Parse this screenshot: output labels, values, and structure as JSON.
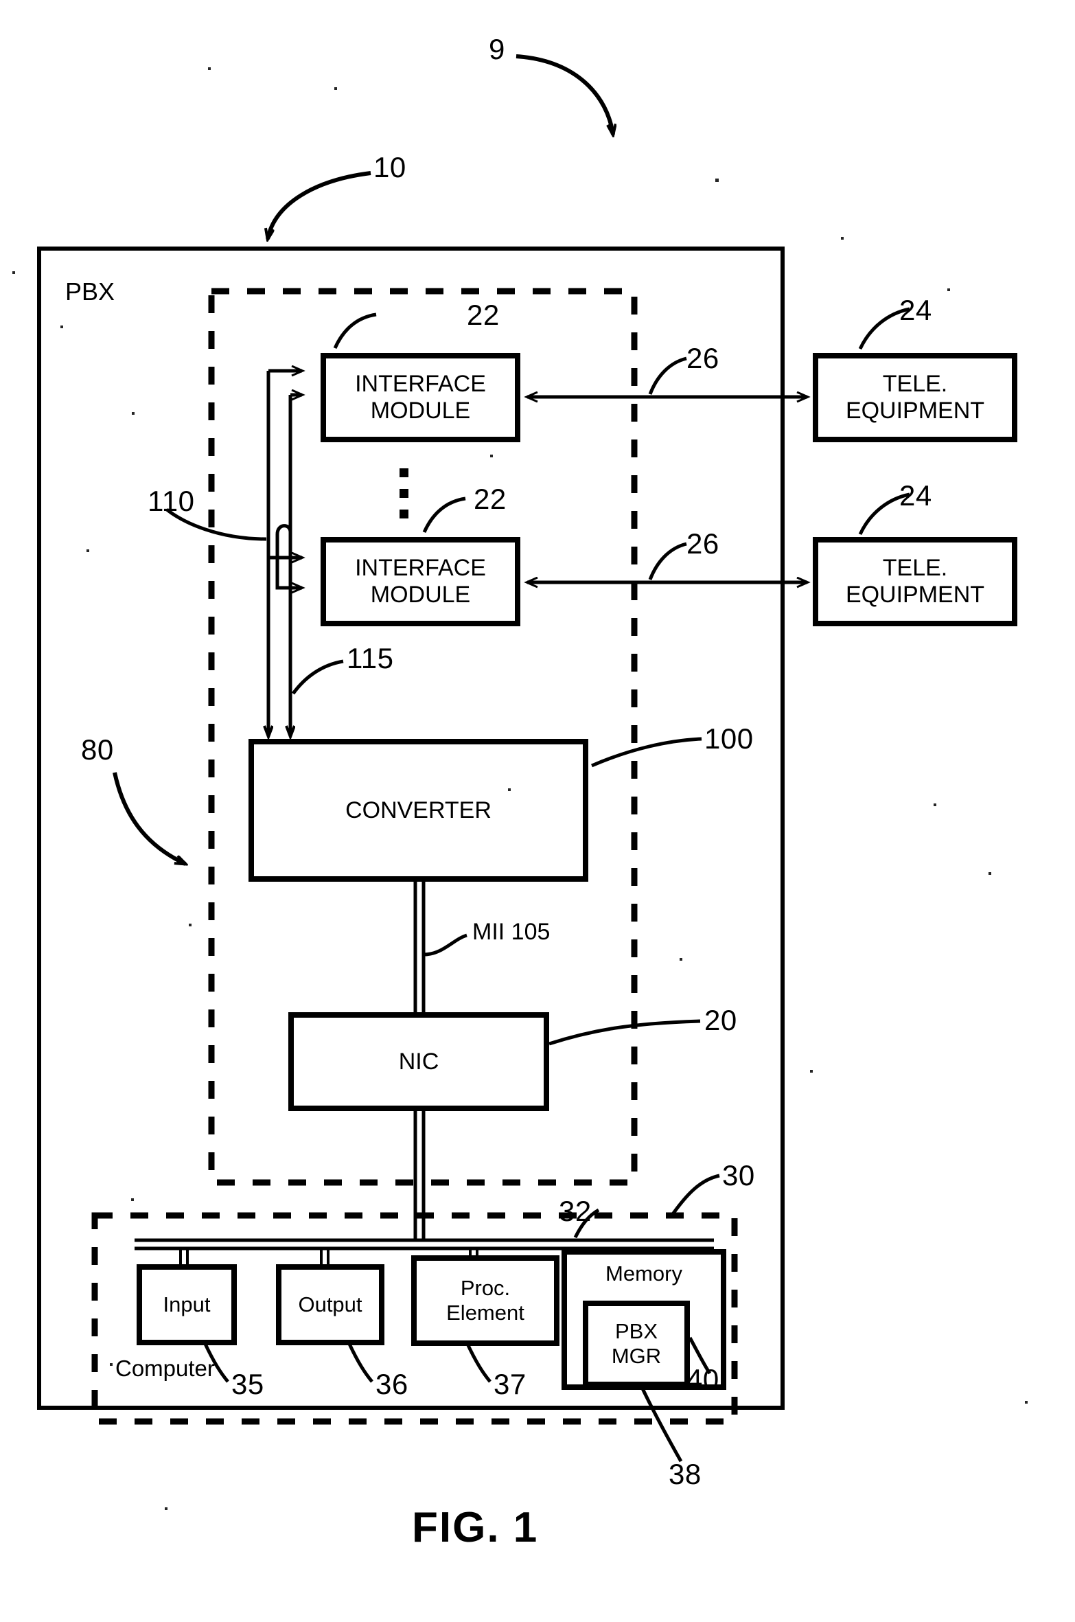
{
  "figure": {
    "caption": "FIG. 1",
    "system_ref": "9",
    "pbx_ref": "10",
    "pbx_label": "PBX"
  },
  "refs": {
    "system": "9",
    "pbx": "10",
    "interface_module_top": "22",
    "interface_module_bottom": "22",
    "tele_equipment_top": "24",
    "tele_equipment_bottom": "24",
    "line_26_top": "26",
    "line_26_bottom": "26",
    "bus_110": "110",
    "bus_115": "115",
    "converter": "100",
    "nic": "20",
    "computer": "30",
    "system_80": "80",
    "mii": "MII 105",
    "computer_bus": "32",
    "input": "35",
    "output": "36",
    "proc_element": "37",
    "memory": "38",
    "pbx_mgr": "40"
  },
  "blocks": {
    "interface_module_top": "INTERFACE\nMODULE",
    "interface_module_bottom": "INTERFACE\nMODULE",
    "tele_equipment_top": "TELE.\nEQUIPMENT",
    "tele_equipment_bottom": "TELE.\nEQUIPMENT",
    "converter": "CONVERTER",
    "nic": "NIC",
    "input": "Input",
    "output": "Output",
    "proc_element": "Proc.\nElement",
    "memory": "Memory",
    "pbx_mgr": "PBX\nMGR",
    "computer": "Computer"
  },
  "ellipsis": "⋮",
  "colors": {
    "stroke": "#000000",
    "background": "#ffffff"
  }
}
